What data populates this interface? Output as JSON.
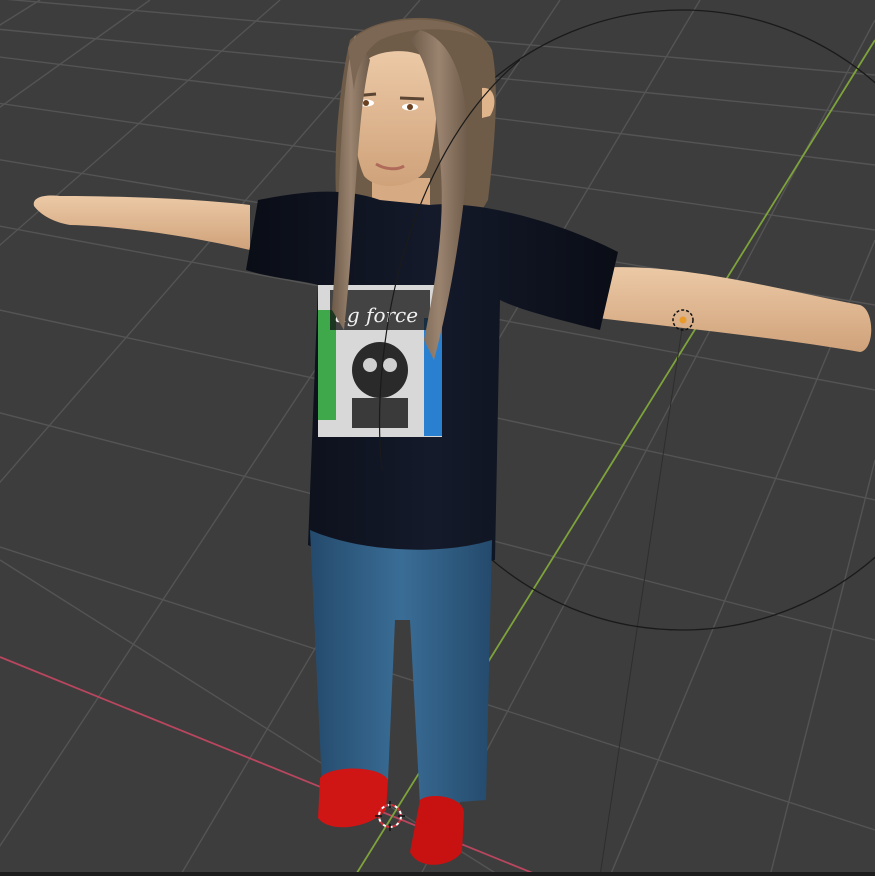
{
  "viewport": {
    "mode": "3d-viewport",
    "shading": "material-preview",
    "background_color": "#3d3d3d",
    "grid_color": "#555555",
    "x_axis_color": "#b8465e",
    "y_axis_color": "#7ea33b"
  },
  "scene": {
    "character": {
      "pose": "t-pose",
      "hair_color": "#8a735e",
      "skin_color": "#e3bc97",
      "shirt_color": "#0d111c",
      "jeans_color": "#2f5c82",
      "shoe_color": "#d01515",
      "shirt_print_text": "ug force"
    },
    "light_gizmo": {
      "shape": "circle",
      "color": "#1a1a1a"
    },
    "object_origin_color": "#e89a2a",
    "cursor_3d_colors": [
      "#ffffff",
      "#d0303a"
    ]
  }
}
